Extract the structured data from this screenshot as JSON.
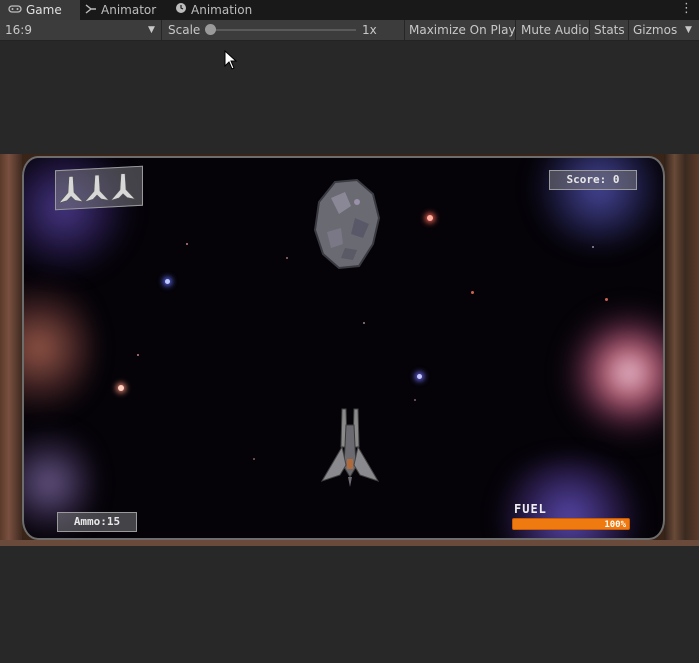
{
  "tabs": [
    {
      "label": "Game",
      "icon": "gamepad-icon",
      "active": true
    },
    {
      "label": "Animator",
      "icon": "animator-icon",
      "active": false
    },
    {
      "label": "Animation",
      "icon": "clock-icon",
      "active": false
    }
  ],
  "toolbar": {
    "aspect": "16:9",
    "scale_label": "Scale",
    "scale_value": "1x",
    "maximize_on_play": "Maximize On Play",
    "mute_audio": "Mute Audio",
    "stats": "Stats",
    "gizmos": "Gizmos"
  },
  "hud": {
    "lives": 3,
    "score": "Score: 0",
    "ammo": "Ammo:15",
    "fuel_label": "FUEL",
    "fuel_value": "100%",
    "fuel_fraction": 1.0
  },
  "colors": {
    "editor_bg": "#282828",
    "toolbar_bg": "#3c3c3c",
    "space_bg": "#050308",
    "fuel_orange": "#ee7a10"
  }
}
